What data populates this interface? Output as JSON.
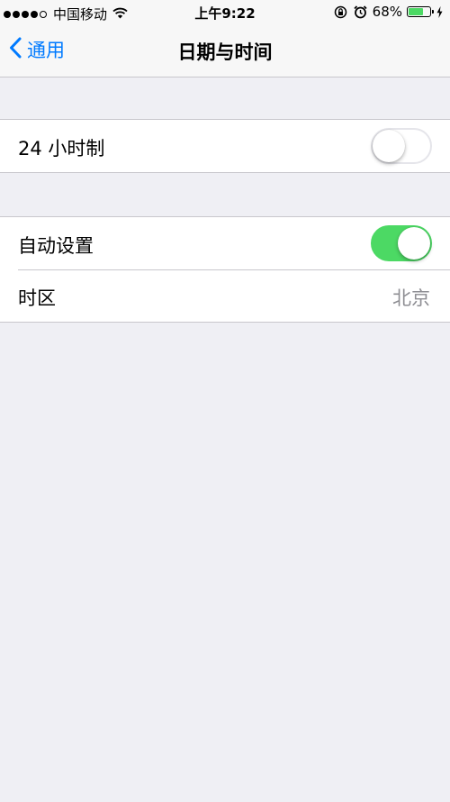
{
  "status_bar": {
    "carrier": "中国移动",
    "time": "上午9:22",
    "battery_percent": "68%",
    "battery_level": 0.68,
    "icons": [
      "signal-dots-icon",
      "wifi-icon",
      "rotation-lock-icon",
      "alarm-icon",
      "battery-icon",
      "charging-bolt-icon"
    ]
  },
  "nav": {
    "back_label": "通用",
    "title": "日期与时间"
  },
  "settings": {
    "hour24": {
      "label": "24 小时制",
      "enabled": false
    },
    "auto_set": {
      "label": "自动设置",
      "enabled": true
    },
    "timezone": {
      "label": "时区",
      "value": "北京"
    }
  },
  "colors": {
    "accent": "#007aff",
    "toggle_on": "#4cd964",
    "background": "#efeff4",
    "secondary_text": "#8e8e93"
  }
}
